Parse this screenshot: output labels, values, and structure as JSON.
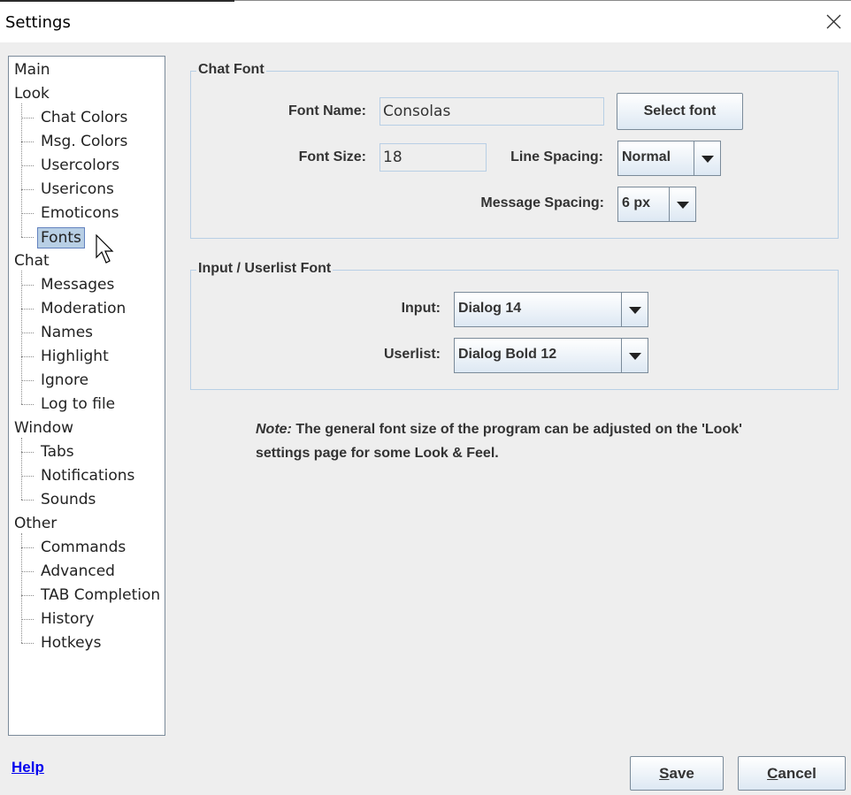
{
  "window": {
    "title": "Settings"
  },
  "tree": {
    "items": [
      {
        "label": "Main",
        "level": 0
      },
      {
        "label": "Look",
        "level": 0
      },
      {
        "label": "Chat Colors",
        "level": 1
      },
      {
        "label": "Msg. Colors",
        "level": 1
      },
      {
        "label": "Usercolors",
        "level": 1
      },
      {
        "label": "Usericons",
        "level": 1
      },
      {
        "label": "Emoticons",
        "level": 1
      },
      {
        "label": "Fonts",
        "level": 1,
        "selected": true
      },
      {
        "label": "Chat",
        "level": 0
      },
      {
        "label": "Messages",
        "level": 1
      },
      {
        "label": "Moderation",
        "level": 1
      },
      {
        "label": "Names",
        "level": 1
      },
      {
        "label": "Highlight",
        "level": 1
      },
      {
        "label": "Ignore",
        "level": 1
      },
      {
        "label": "Log to file",
        "level": 1
      },
      {
        "label": "Window",
        "level": 0
      },
      {
        "label": "Tabs",
        "level": 1
      },
      {
        "label": "Notifications",
        "level": 1
      },
      {
        "label": "Sounds",
        "level": 1
      },
      {
        "label": "Other",
        "level": 0
      },
      {
        "label": "Commands",
        "level": 1
      },
      {
        "label": "Advanced",
        "level": 1
      },
      {
        "label": "TAB Completion",
        "level": 1
      },
      {
        "label": "History",
        "level": 1
      },
      {
        "label": "Hotkeys",
        "level": 1
      }
    ]
  },
  "chat_font": {
    "title": "Chat Font",
    "font_name_label": "Font Name:",
    "font_name_value": "Consolas",
    "select_font_label": "Select font",
    "font_size_label": "Font Size:",
    "font_size_value": "18",
    "line_spacing_label": "Line Spacing:",
    "line_spacing_value": "Normal",
    "message_spacing_label": "Message Spacing:",
    "message_spacing_value": "6 px"
  },
  "input_font": {
    "title": "Input / Userlist Font",
    "input_label": "Input:",
    "input_value": "Dialog 14",
    "userlist_label": "Userlist:",
    "userlist_value": "Dialog Bold 12"
  },
  "note": {
    "prefix": "Note:",
    "text": " The general font size of the program can be adjusted on the 'Look' settings page for some Look & Feel."
  },
  "footer": {
    "help": "Help",
    "save_mnemonic": "S",
    "save_rest": "ave",
    "cancel_mnemonic": "C",
    "cancel_rest": "ancel"
  }
}
